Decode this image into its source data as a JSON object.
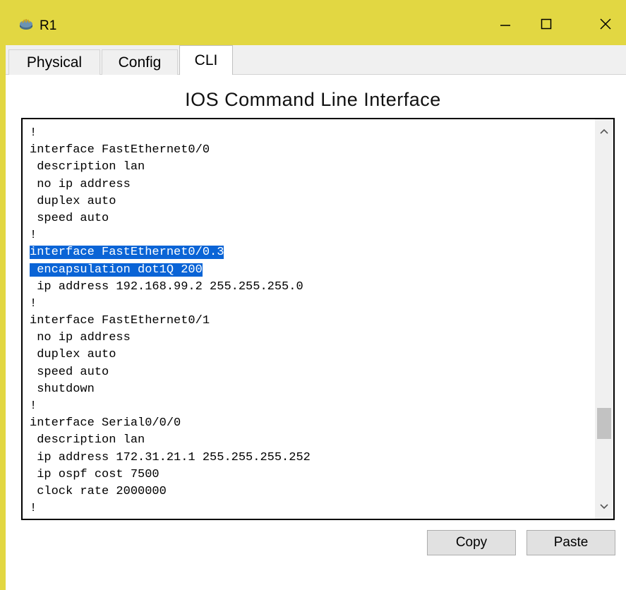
{
  "window": {
    "title": "R1",
    "icon": "router-icon",
    "controls": [
      "minimize-icon",
      "maximize-icon",
      "close-icon"
    ]
  },
  "tabs": [
    {
      "label": "Physical",
      "active": false
    },
    {
      "label": "Config",
      "active": false
    },
    {
      "label": "CLI",
      "active": true
    }
  ],
  "heading": "IOS Command Line Interface",
  "terminal": {
    "lines": [
      {
        "text": "!",
        "selected": false
      },
      {
        "text": "interface FastEthernet0/0",
        "selected": false
      },
      {
        "text": " description lan",
        "selected": false
      },
      {
        "text": " no ip address",
        "selected": false
      },
      {
        "text": " duplex auto",
        "selected": false
      },
      {
        "text": " speed auto",
        "selected": false
      },
      {
        "text": "!",
        "selected": false
      },
      {
        "text": "interface FastEthernet0/0.3",
        "selected": true
      },
      {
        "text": " encapsulation dot1Q 200",
        "selected": true
      },
      {
        "text": " ip address 192.168.99.2 255.255.255.0",
        "selected": false
      },
      {
        "text": "!",
        "selected": false
      },
      {
        "text": "interface FastEthernet0/1",
        "selected": false
      },
      {
        "text": " no ip address",
        "selected": false
      },
      {
        "text": " duplex auto",
        "selected": false
      },
      {
        "text": " speed auto",
        "selected": false
      },
      {
        "text": " shutdown",
        "selected": false
      },
      {
        "text": "!",
        "selected": false
      },
      {
        "text": "interface Serial0/0/0",
        "selected": false
      },
      {
        "text": " description lan",
        "selected": false
      },
      {
        "text": " ip address 172.31.21.1 255.255.255.252",
        "selected": false
      },
      {
        "text": " ip ospf cost 7500",
        "selected": false
      },
      {
        "text": " clock rate 2000000",
        "selected": false
      },
      {
        "text": "!",
        "selected": false
      }
    ],
    "selection_color": "#0a64d6"
  },
  "buttons": {
    "copy": "Copy",
    "paste": "Paste"
  },
  "colors": {
    "titlebar": "#e2d742"
  }
}
